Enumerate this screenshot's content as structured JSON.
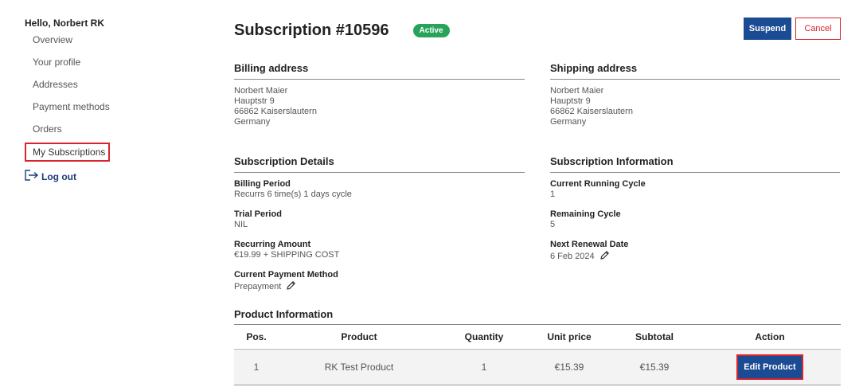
{
  "sidebar": {
    "greeting": "Hello, Norbert RK",
    "items": [
      {
        "label": "Overview"
      },
      {
        "label": "Your profile"
      },
      {
        "label": "Addresses"
      },
      {
        "label": "Payment methods"
      },
      {
        "label": "Orders"
      },
      {
        "label": "My Subscriptions"
      }
    ],
    "logout": "Log out"
  },
  "header": {
    "title": "Subscription #10596",
    "status": "Active",
    "suspend_label": "Suspend",
    "cancel_label": "Cancel"
  },
  "billing_address": {
    "heading": "Billing address",
    "lines": [
      "Norbert Maier",
      "Hauptstr 9",
      "66862 Kaiserslautern",
      "Germany"
    ]
  },
  "shipping_address": {
    "heading": "Shipping address",
    "lines": [
      "Norbert Maier",
      "Hauptstr 9",
      "66862 Kaiserslautern",
      "Germany"
    ]
  },
  "subscription_details": {
    "heading": "Subscription Details",
    "billing_period_label": "Billing Period",
    "billing_period_value": "Recurrs 6 time(s) 1 days cycle",
    "trial_period_label": "Trial Period",
    "trial_period_value": "NIL",
    "recurring_amount_label": "Recurring Amount",
    "recurring_amount_value": "€19.99 + SHIPPING COST",
    "payment_method_label": "Current Payment Method",
    "payment_method_value": "Prepayment"
  },
  "subscription_information": {
    "heading": "Subscription Information",
    "current_cycle_label": "Current Running Cycle",
    "current_cycle_value": "1",
    "remaining_cycle_label": "Remaining Cycle",
    "remaining_cycle_value": "5",
    "next_renewal_label": "Next Renewal Date",
    "next_renewal_value": "6 Feb 2024"
  },
  "product_information": {
    "heading": "Product Information",
    "columns": [
      "Pos.",
      "Product",
      "Quantity",
      "Unit price",
      "Subtotal",
      "Action"
    ],
    "rows": [
      {
        "pos": "1",
        "product": "RK Test Product",
        "quantity": "1",
        "unit_price": "€15.39",
        "subtotal": "€15.39",
        "action": "Edit Product"
      }
    ]
  },
  "colors": {
    "primary": "#1a4b93",
    "danger": "#d9232d",
    "active": "#27a35a"
  },
  "icons": {
    "logout": "logout-arrow-icon",
    "edit": "pencil-icon"
  }
}
